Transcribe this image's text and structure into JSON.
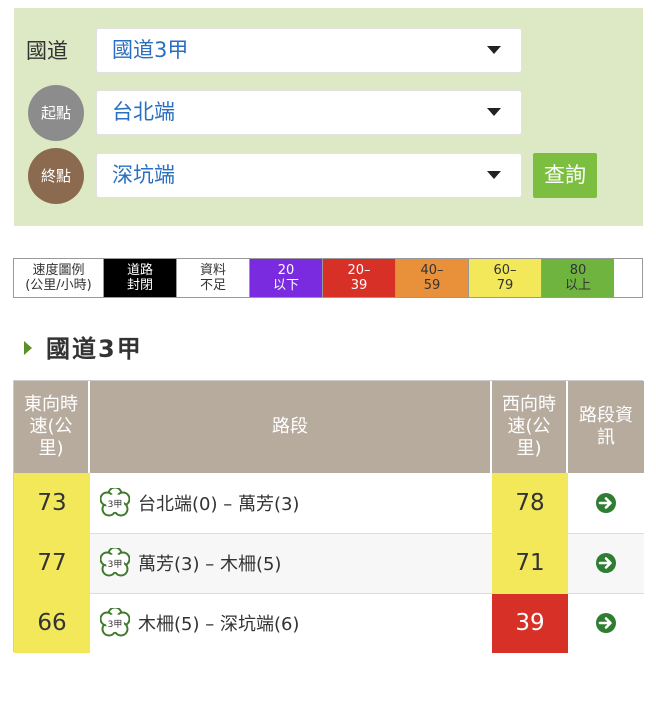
{
  "search": {
    "road_label": "國道",
    "road_value": "國道3甲",
    "start_label": "起點",
    "start_value": "台北端",
    "end_label": "終點",
    "end_value": "深坑端",
    "query_button": "查詢"
  },
  "legend": [
    {
      "label": "速度圖例\n(公里/小時)",
      "bg": "#ffffff",
      "fg": "#333333"
    },
    {
      "label": "道路\n封閉",
      "bg": "#000000",
      "fg": "#ffffff"
    },
    {
      "label": "資料\n不足",
      "bg": "#ffffff",
      "fg": "#333333"
    },
    {
      "label": "20\n以下",
      "bg": "#7a2be0",
      "fg": "#ffffff"
    },
    {
      "label": "20–\n39",
      "bg": "#d73027",
      "fg": "#ffffff"
    },
    {
      "label": "40–\n59",
      "bg": "#e8913a",
      "fg": "#333333"
    },
    {
      "label": "60–\n79",
      "bg": "#f2e85a",
      "fg": "#333333"
    },
    {
      "label": "80\n以上",
      "bg": "#6fb43f",
      "fg": "#333333"
    }
  ],
  "section_title": "國道3甲",
  "table": {
    "headers": {
      "east": "東向時\n速(公\n里)",
      "segment": "路段",
      "west": "西向時\n速(公\n里)",
      "info": "路段資\n訊"
    },
    "badge_text": "3甲",
    "rows": [
      {
        "east": "73",
        "east_color": "#f2e85a",
        "segment": "台北端(0) – 萬芳(3)",
        "west": "78",
        "west_color": "#f2e85a"
      },
      {
        "east": "77",
        "east_color": "#f2e85a",
        "segment": "萬芳(3) – 木柵(5)",
        "west": "71",
        "west_color": "#f2e85a"
      },
      {
        "east": "66",
        "east_color": "#f2e85a",
        "segment": "木柵(5) – 深坑端(6)",
        "west": "39",
        "west_color": "#d73027"
      }
    ]
  },
  "colors": {
    "panel_bg": "#dde9c4",
    "select_text": "#2a6fc0",
    "query_button": "#7cbe3f",
    "table_header": "#b7ab9e",
    "info_arrow": "#2e7d32"
  }
}
